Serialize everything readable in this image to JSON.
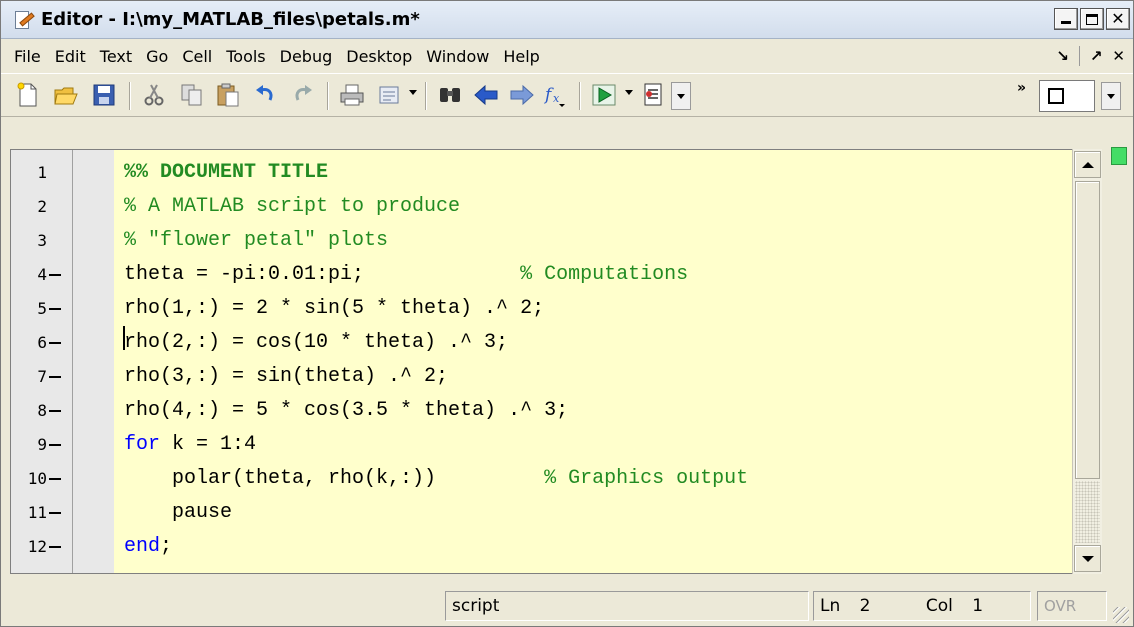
{
  "window": {
    "title": "Editor - I:\\my_MATLAB_files\\petals.m*",
    "controls": [
      "minimize",
      "maximize",
      "close"
    ]
  },
  "menubar": {
    "items": [
      "File",
      "Edit",
      "Text",
      "Go",
      "Cell",
      "Tools",
      "Debug",
      "Desktop",
      "Window",
      "Help"
    ],
    "right_glyphs": [
      "↘",
      "↗",
      "✕"
    ]
  },
  "toolbar": {
    "buttons": [
      "new-file-icon",
      "open-folder-icon",
      "save-icon",
      "cut-icon",
      "copy-icon",
      "paste-icon",
      "undo-icon",
      "redo-icon",
      "print-icon",
      "publish-icon",
      "find-icon",
      "back-icon",
      "forward-icon",
      "function-icon",
      "run-icon",
      "breakpoint-icon",
      "stack-dropdown",
      "layout-box"
    ],
    "chevron": "»"
  },
  "editor": {
    "lines": [
      {
        "num": "1",
        "exec": false,
        "tokens": [
          {
            "t": "%% DOCUMENT TITLE",
            "c": "cell"
          }
        ]
      },
      {
        "num": "2",
        "exec": false,
        "tokens": [
          {
            "t": "% A MATLAB script to produce",
            "c": "cm"
          }
        ]
      },
      {
        "num": "3",
        "exec": false,
        "tokens": [
          {
            "t": "% \"flower petal\" plots",
            "c": "cm"
          }
        ]
      },
      {
        "num": "4",
        "exec": true,
        "tokens": [
          {
            "t": "theta = -pi:0.01:pi;             ",
            "c": ""
          },
          {
            "t": "% Computations",
            "c": "cm"
          }
        ]
      },
      {
        "num": "5",
        "exec": true,
        "tokens": [
          {
            "t": "rho(1,:) = 2 * sin(5 * theta) .^ 2;",
            "c": ""
          }
        ]
      },
      {
        "num": "6",
        "exec": true,
        "tokens": [
          {
            "t": "rho(2,:) = cos(10 * theta) .^ 3;",
            "c": ""
          }
        ]
      },
      {
        "num": "7",
        "exec": true,
        "tokens": [
          {
            "t": "rho(3,:) = sin(theta) .^ 2;",
            "c": ""
          }
        ]
      },
      {
        "num": "8",
        "exec": true,
        "tokens": [
          {
            "t": "rho(4,:) = 5 * cos(3.5 * theta) .^ 3;",
            "c": ""
          }
        ]
      },
      {
        "num": "9",
        "exec": true,
        "tokens": [
          {
            "t": "for",
            "c": "kw"
          },
          {
            "t": " k = 1:4",
            "c": ""
          }
        ]
      },
      {
        "num": "10",
        "exec": true,
        "tokens": [
          {
            "t": "    polar(theta, rho(k,:))         ",
            "c": ""
          },
          {
            "t": "% Graphics output",
            "c": "cm"
          }
        ]
      },
      {
        "num": "11",
        "exec": true,
        "tokens": [
          {
            "t": "    pause",
            "c": ""
          }
        ]
      },
      {
        "num": "12",
        "exec": true,
        "tokens": [
          {
            "t": "end",
            "c": "kw"
          },
          {
            "t": ";",
            "c": ""
          }
        ]
      }
    ]
  },
  "statusbar": {
    "mode": "script",
    "ln_label": "Ln",
    "ln_value": "2",
    "col_label": "Col",
    "col_value": "1",
    "ovr": "OVR"
  }
}
